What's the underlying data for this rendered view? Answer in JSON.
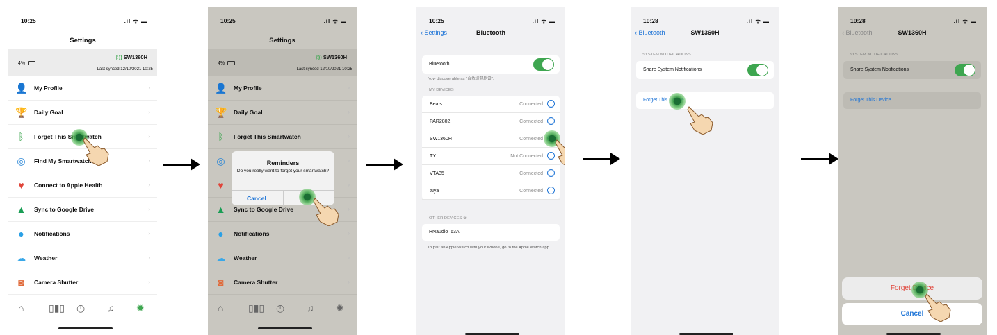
{
  "steps": [
    {
      "time": "10:25",
      "title": "Settings",
      "device_name": "SW1360H",
      "battery": "4%",
      "last_synced": "Last synced 12/10/2021 10:25",
      "menu": [
        {
          "label": "My Profile",
          "icon": "person-icon"
        },
        {
          "label": "Daily Goal",
          "icon": "trophy-icon"
        },
        {
          "label": "Forget This Smartwatch",
          "icon": "bluetooth-watch-icon"
        },
        {
          "label": "Find My Smartwatch",
          "icon": "find-icon"
        },
        {
          "label": "Connect to Apple Health",
          "icon": "heart-icon"
        },
        {
          "label": "Sync to Google Drive",
          "icon": "drive-icon"
        },
        {
          "label": "Notifications",
          "icon": "chat-icon"
        },
        {
          "label": "Weather",
          "icon": "weather-icon"
        },
        {
          "label": "Camera Shutter",
          "icon": "camera-icon"
        }
      ],
      "tabs": [
        "home-icon",
        "stats-icon",
        "clock-icon",
        "bell-icon",
        "gear-icon"
      ]
    },
    {
      "dialog": {
        "title": "Reminders",
        "message": "Do you really want to forget your smartwatch?",
        "cancel": "Cancel"
      }
    },
    {
      "time": "10:25",
      "back": "Settings",
      "title": "Bluetooth",
      "bluetooth_label": "Bluetooth",
      "discoverable": "Now discoverable as \"合依适蓝剧设\".",
      "my_devices_header": "MY DEVICES",
      "devices": [
        {
          "name": "Beats",
          "status": "Connected"
        },
        {
          "name": "PAR2802",
          "status": "Connected"
        },
        {
          "name": "SW1360H",
          "status": "Connected"
        },
        {
          "name": "TY",
          "status": "Not Connected"
        },
        {
          "name": "VTA35",
          "status": "Connected"
        },
        {
          "name": "tuya",
          "status": "Connected"
        }
      ],
      "other_devices_header": "OTHER DEVICES",
      "other_device": "HNaudio_63A",
      "note": "To pair an Apple Watch with your iPhone, go to the Apple Watch app."
    },
    {
      "time": "10:28",
      "back": "Bluetooth",
      "title": "SW1360H",
      "section": "SYSTEM NOTIFICATIONS",
      "share_label": "Share System Notifications",
      "forget_label": "Forget This Device"
    },
    {
      "time": "10:28",
      "back": "Bluetooth",
      "title": "SW1360H",
      "section": "SYSTEM NOTIFICATIONS",
      "share_label": "Share System Notifications",
      "forget_label": "Forget This Device",
      "sheet_forget": "Forget Device",
      "sheet_cancel": "Cancel"
    }
  ],
  "colors": {
    "accent": "#1a72d6",
    "toggle_on": "#3ea650",
    "destructive": "#e0453a",
    "dim_overlay": "#c9c7c0",
    "tap_marker": "#3f9e4c"
  }
}
